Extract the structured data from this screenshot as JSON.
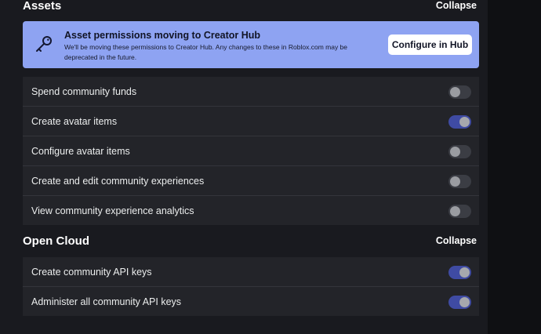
{
  "assets": {
    "title": "Assets",
    "collapse_label": "Collapse",
    "banner": {
      "icon": "key-icon",
      "title": "Asset permissions moving to Creator Hub",
      "text": "We'll be moving these permissions to Creator Hub. Any changes to these in Roblox.com may be deprecated in the future.",
      "button_label": "Configure in Hub"
    },
    "permissions": [
      {
        "label": "Spend community funds",
        "enabled": false
      },
      {
        "label": "Create avatar items",
        "enabled": true
      },
      {
        "label": "Configure avatar items",
        "enabled": false
      },
      {
        "label": "Create and edit community experiences",
        "enabled": false
      },
      {
        "label": "View community experience analytics",
        "enabled": false
      }
    ]
  },
  "open_cloud": {
    "title": "Open Cloud",
    "collapse_label": "Collapse",
    "permissions": [
      {
        "label": "Create community API keys",
        "enabled": true
      },
      {
        "label": "Administer all community API keys",
        "enabled": true
      }
    ]
  },
  "colors": {
    "banner": "#8ea3f2",
    "toggle_on": "#3f4ba3",
    "toggle_off": "#3b3d44",
    "panel": "#232429",
    "page": "#191a1f"
  }
}
